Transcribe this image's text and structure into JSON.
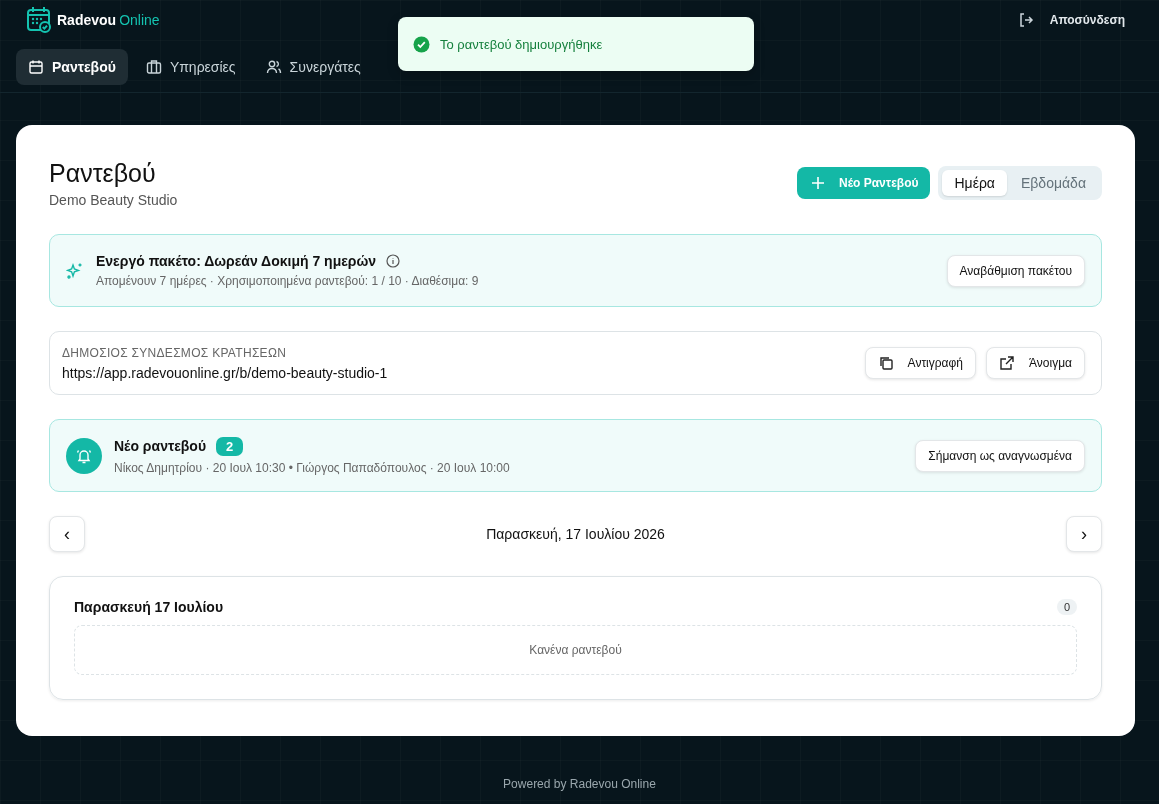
{
  "brand": {
    "name": "Radevou",
    "suffix": "Online"
  },
  "logout": "Αποσύνδεση",
  "nav": [
    {
      "label": "Ραντεβού",
      "selected": true
    },
    {
      "label": "Υπηρεσίες",
      "selected": false
    },
    {
      "label": "Συνεργάτες",
      "selected": false
    }
  ],
  "toast": {
    "message": "Το ραντεβού δημιουργήθηκε"
  },
  "page": {
    "title": "Ραντεβού",
    "subtitle": "Demo Beauty Studio",
    "new_button": "Νέο Ραντεβού",
    "views": [
      {
        "label": "Ημέρα",
        "selected": true
      },
      {
        "label": "Εβδομάδα",
        "selected": false
      }
    ]
  },
  "plan": {
    "title": "Ενεργό πακέτο: Δωρεάν Δοκιμή 7 ημερών",
    "details": "Απομένουν 7 ημέρες · Χρησιμοποιημένα ραντεβού: 1 / 10 · Διαθέσιμα: 9",
    "button": "Αναβάθμιση πακέτου"
  },
  "booking_link": {
    "label": "ΔΗΜΟΣΙΟΣ ΣΥΝΔΕΣΜΟΣ ΚΡΑΤΗΣΕΩΝ",
    "url": "https://app.radevouonline.gr/b/demo-beauty-studio-1",
    "copy_button": "Αντιγραφή",
    "open_button": "Άνοιγμα"
  },
  "notification": {
    "title": "Νέο ραντεβού",
    "count": "2",
    "details": "Νίκος Δημητρίου · 20 Ιουλ 10:30 • Γιώργος Παπαδόπουλος · 20 Ιουλ 10:00",
    "button": "Σήμανση ως αναγνωσμένα"
  },
  "date_nav": {
    "date": "Παρασκευή, 17 Ιουλίου 2026",
    "prev": "‹",
    "next": "›"
  },
  "day": {
    "title": "Παρασκευή 17 Ιουλίου",
    "count": "0",
    "empty": "Κανένα ραντεβού"
  },
  "footer": "Powered by Radevou Online"
}
